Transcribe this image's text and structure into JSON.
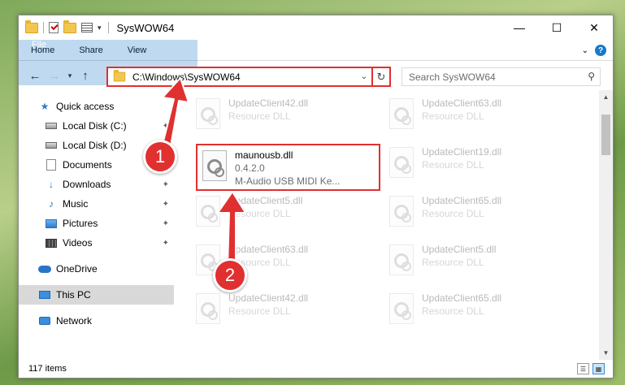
{
  "window": {
    "title": "SysWOW64",
    "controls": {
      "minimize": "—",
      "maximize": "☐",
      "close": "✕"
    }
  },
  "ribbon": {
    "tabs": [
      "File",
      "Home",
      "Share",
      "View"
    ],
    "help": "?"
  },
  "navigation": {
    "address": "C:\\Windows\\SysWOW64",
    "search_placeholder": "Search SysWOW64"
  },
  "sidebar": {
    "items": [
      {
        "label": "Quick access",
        "icon": "star-icon"
      },
      {
        "label": "Local Disk (C:)",
        "icon": "drive-icon",
        "pinned": true
      },
      {
        "label": "Local Disk (D:)",
        "icon": "drive-icon",
        "pinned": true
      },
      {
        "label": "Documents",
        "icon": "documents-icon",
        "pinned": true
      },
      {
        "label": "Downloads",
        "icon": "download-icon",
        "pinned": true
      },
      {
        "label": "Music",
        "icon": "music-icon",
        "pinned": true
      },
      {
        "label": "Pictures",
        "icon": "pictures-icon",
        "pinned": true
      },
      {
        "label": "Videos",
        "icon": "videos-icon",
        "pinned": true
      },
      {
        "label": "OneDrive",
        "icon": "cloud-icon"
      },
      {
        "label": "This PC",
        "icon": "computer-icon",
        "selected": true
      },
      {
        "label": "Network",
        "icon": "network-icon"
      }
    ]
  },
  "files": {
    "focused": {
      "name": "maunousb.dll",
      "version": "0.4.2.0",
      "description": "M-Audio USB MIDI Ke..."
    },
    "faded": [
      {
        "name": "UpdateClient42.dll",
        "type": "Resource DLL"
      },
      {
        "name": "UpdateClient63.dll",
        "type": "Resource DLL"
      },
      {
        "name": "UpdateClient19.dll",
        "type": "Resource DLL"
      },
      {
        "name": "UpdateClient5.dll",
        "type": "Resource DLL"
      },
      {
        "name": "UpdateClient65.dll",
        "type": "Resource DLL"
      },
      {
        "name": "UpdateClient63.dll",
        "type": "Resource DLL"
      },
      {
        "name": "UpdateClient5.dll",
        "type": "Resource DLL"
      },
      {
        "name": "UpdateClient42.dll",
        "type": "Resource DLL"
      },
      {
        "name": "UpdateClient65.dll",
        "type": "Resource DLL"
      }
    ]
  },
  "status": {
    "item_count": "117 items"
  },
  "annotations": {
    "step1": "1",
    "step2": "2",
    "color": "#e03030"
  }
}
